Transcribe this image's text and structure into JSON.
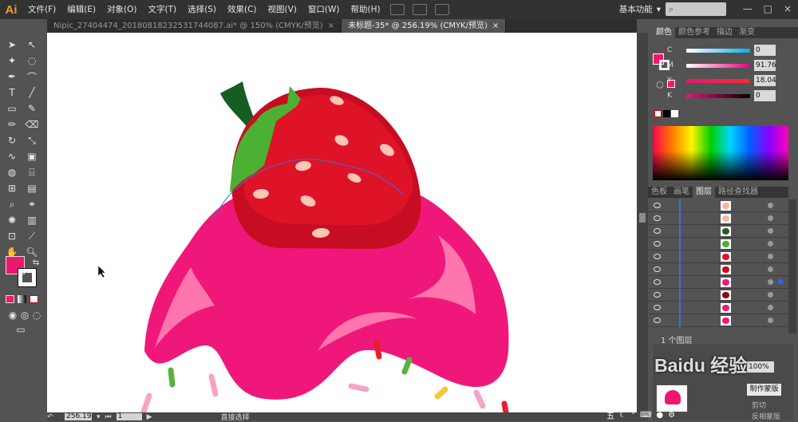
{
  "app": {
    "logo": "Ai",
    "workspace": "基本功能"
  },
  "menus": [
    "文件(F)",
    "编辑(E)",
    "对象(O)",
    "文字(T)",
    "选择(S)",
    "效果(C)",
    "视图(V)",
    "窗口(W)",
    "帮助(H)"
  ],
  "tabs": [
    {
      "label": "Nipic_27404474_20180818232531744087.ai* @ 150% (CMYK/预览)",
      "active": false,
      "close": "×"
    },
    {
      "label": "未标题-35* @ 256.19% (CMYK/预览)",
      "active": true,
      "close": "×"
    }
  ],
  "colors": {
    "accent": "#e91e63",
    "strawberry": "#dd1128",
    "cream": "#f21b7d",
    "leaf": "#4cb033"
  },
  "color_panel": {
    "tabs": [
      "颜色",
      "颜色参考",
      "描边",
      "渐变"
    ],
    "sliders": [
      {
        "label": "C",
        "value": "0"
      },
      {
        "label": "M",
        "value": "91.76"
      },
      {
        "label": "Y",
        "value": "18.04"
      },
      {
        "label": "K",
        "value": "0"
      }
    ]
  },
  "layers_panel": {
    "tabs": [
      "色板",
      "画笔",
      "图层",
      "路径查找器"
    ],
    "count_label": "1 个图层",
    "row_count": 10
  },
  "side_labels": [
    "剪切",
    "反相蒙版",
    "制作蒙版"
  ],
  "zoom_value": "100%",
  "status": {
    "zoom": "256.19",
    "page": "1",
    "tool": "直接选择"
  },
  "taskbar": {
    "ime": "五"
  },
  "watermark": "Baidu 经验"
}
